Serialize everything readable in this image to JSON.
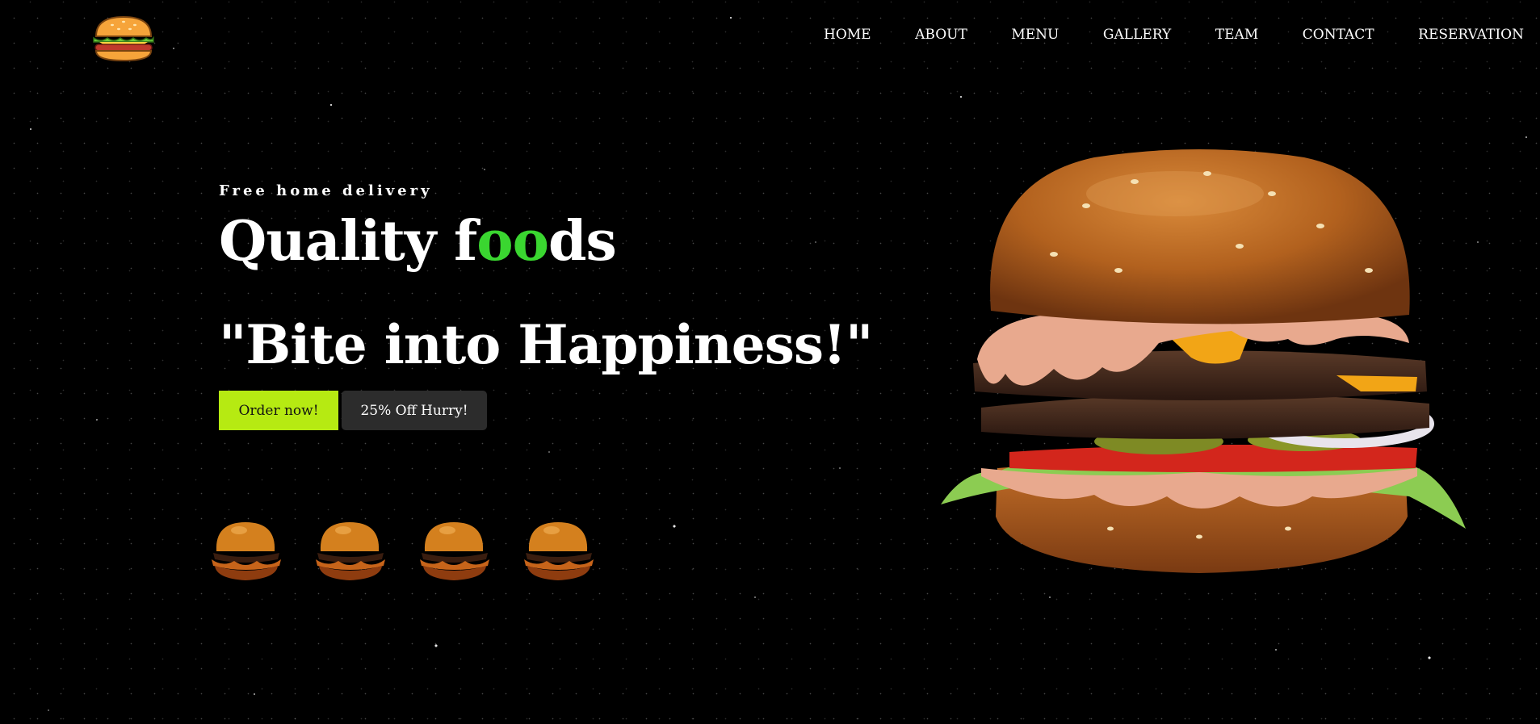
{
  "header": {
    "logo": "burger-logo-icon",
    "nav": [
      {
        "label": "HOME"
      },
      {
        "label": "ABOUT"
      },
      {
        "label": "MENU"
      },
      {
        "label": "GALLERY"
      },
      {
        "label": "TEAM"
      },
      {
        "label": "CONTACT"
      },
      {
        "label": "RESERVATION"
      }
    ]
  },
  "hero": {
    "tagline": "Free home delivery",
    "title_prefix": "Quality f",
    "title_accent": "oo",
    "title_suffix": "ds",
    "slogan": "\"Bite into Happiness!\"",
    "order_button": "Order now!",
    "offer_button": "25% Off Hurry!"
  },
  "gallery_thumbnails": [
    {
      "icon": "burger-thumbnail-icon"
    },
    {
      "icon": "burger-thumbnail-icon"
    },
    {
      "icon": "burger-thumbnail-icon"
    },
    {
      "icon": "burger-thumbnail-icon"
    }
  ],
  "hero_image": {
    "icon": "burger-hero-image"
  },
  "colors": {
    "background": "#000000",
    "accent_green": "#3ad630",
    "button_primary": "#b6ea12",
    "button_secondary": "#2c2c2c",
    "text": "#ffffff"
  }
}
